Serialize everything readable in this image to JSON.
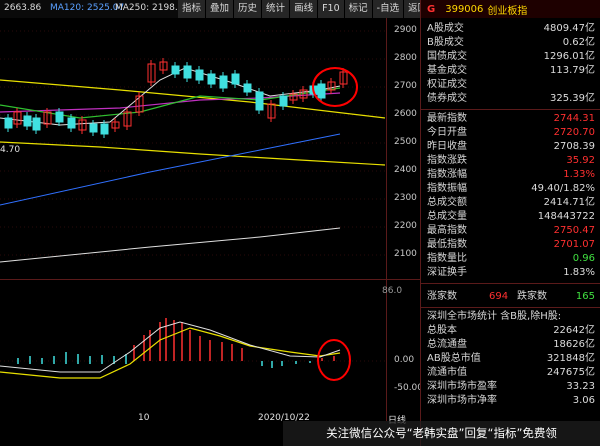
{
  "chart_panel": {
    "ma_labels": [
      {
        "text": "2663.86",
        "color": "#dcdcdc"
      },
      {
        "text": "MA120: 2525.07",
        "color": "#5aa0ff"
      },
      {
        "text": "MA250: 2198.07",
        "color": "#dcdcdc"
      }
    ],
    "price_axis": [
      "2900",
      "2800",
      "2700",
      "2600",
      "2500",
      "2400",
      "2300",
      "2200",
      "2100"
    ],
    "macd_axis": [
      "0.00",
      "-50.00"
    ],
    "macd_top": "86.0",
    "low_label": "4.70",
    "x_labels": [
      "10",
      "2020/10/22",
      "日线"
    ],
    "colors": {
      "up": "#ff3030",
      "down": "#40e0e0",
      "highlight_circle": "#ff0000",
      "grid": "#5a1a1a"
    }
  },
  "toolbar": [
    "指标",
    "叠加",
    "历史",
    "统计",
    "画线",
    "F10",
    "标记",
    "-自选",
    "返回"
  ],
  "quote": {
    "code": "399006",
    "name": "创业板指",
    "badge": "G",
    "volumes": [
      {
        "label": "A股成交",
        "value": "4809.47亿",
        "color": "#dcdcdc"
      },
      {
        "label": "B股成交",
        "value": "0.62亿",
        "color": "#dcdcdc"
      },
      {
        "label": "国债成交",
        "value": "1296.01亿",
        "color": "#dcdcdc"
      },
      {
        "label": "基金成交",
        "value": "113.79亿",
        "color": "#dcdcdc"
      },
      {
        "label": "权证成交",
        "value": "",
        "color": "#dcdcdc"
      },
      {
        "label": "债券成交",
        "value": "325.39亿",
        "color": "#dcdcdc"
      }
    ],
    "index": [
      {
        "label": "最新指数",
        "value": "2744.31",
        "color": "#ff3030"
      },
      {
        "label": "今日开盘",
        "value": "2720.70",
        "color": "#ff3030"
      },
      {
        "label": "昨日收盘",
        "value": "2708.39",
        "color": "#dcdcdc"
      },
      {
        "label": "指数涨跌",
        "value": "35.92",
        "color": "#ff3030"
      },
      {
        "label": "指数涨幅",
        "value": "1.33%",
        "color": "#ff3030"
      },
      {
        "label": "指数振幅",
        "value": "49.40/1.82%",
        "color": "#dcdcdc"
      },
      {
        "label": "总成交额",
        "value": "2414.71亿",
        "color": "#dcdcdc"
      },
      {
        "label": "总成交量",
        "value": "148443722",
        "color": "#dcdcdc"
      },
      {
        "label": "最高指数",
        "value": "2750.47",
        "color": "#ff3030"
      },
      {
        "label": "最低指数",
        "value": "2701.07",
        "color": "#ff3030"
      },
      {
        "label": "指数量比",
        "value": "0.96",
        "color": "#40e040"
      },
      {
        "label": "深证换手",
        "value": "1.83%",
        "color": "#dcdcdc"
      }
    ],
    "updown": {
      "up_label": "涨家数",
      "up_value": "694",
      "down_label": "跌家数",
      "down_value": "165"
    },
    "market_title": "深圳全市场统计 含B股,除H股:",
    "market": [
      {
        "label": "总股本",
        "value": "22642亿"
      },
      {
        "label": "总流通盘",
        "value": "18626亿"
      },
      {
        "label": "AB股总市值",
        "value": "321848亿"
      },
      {
        "label": "流通市值",
        "value": "247675亿"
      },
      {
        "label": "深圳市场市盈率",
        "value": "33.23"
      },
      {
        "label": "深圳市场市净率",
        "value": "3.06"
      }
    ]
  },
  "footer": "关注微信公众号“老韩实盘”回复“指标”免费领"
}
